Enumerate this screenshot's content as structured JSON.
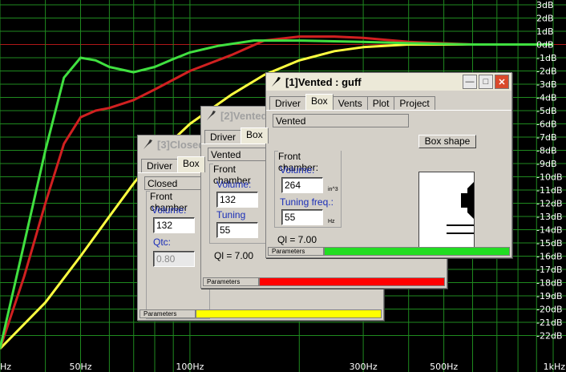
{
  "plot": {
    "db_labels": [
      "3dB",
      "2dB",
      "1dB",
      "0dB",
      "-1dB",
      "-2dB",
      "-3dB",
      "-4dB",
      "-5dB",
      "-6dB",
      "-7dB",
      "-8dB",
      "-9dB",
      "-10dB",
      "-11dB",
      "-12dB",
      "-13dB",
      "-14dB",
      "-15dB",
      "-16dB",
      "-17dB",
      "-18dB",
      "-19dB",
      "-20dB",
      "-21dB",
      "-22dB"
    ],
    "hz_labels": [
      {
        "label": "Hz",
        "f": 30
      },
      {
        "label": "50Hz",
        "f": 50
      },
      {
        "label": "100Hz",
        "f": 100
      },
      {
        "label": "300Hz",
        "f": 300
      },
      {
        "label": "500Hz",
        "f": 500
      },
      {
        "label": "1kHz",
        "f": 1000
      }
    ],
    "grid_color": "#1f8a1f",
    "zero_line_color": "#b01818",
    "curves": [
      {
        "color": "#ffff40",
        "points": [
          [
            30,
            -23
          ],
          [
            40,
            -19.5
          ],
          [
            50,
            -16
          ],
          [
            60,
            -13
          ],
          [
            70,
            -10.5
          ],
          [
            80,
            -8.5
          ],
          [
            100,
            -6
          ],
          [
            130,
            -3.8
          ],
          [
            160,
            -2.3
          ],
          [
            200,
            -1.2
          ],
          [
            250,
            -0.5
          ],
          [
            300,
            -0.2
          ],
          [
            400,
            0
          ],
          [
            600,
            0
          ],
          [
            1000,
            0
          ]
        ]
      },
      {
        "color": "#d02020",
        "points": [
          [
            30,
            -23
          ],
          [
            35,
            -17.5
          ],
          [
            40,
            -12
          ],
          [
            45,
            -7.5
          ],
          [
            50,
            -5.5
          ],
          [
            55,
            -5
          ],
          [
            60,
            -4.8
          ],
          [
            70,
            -4.2
          ],
          [
            80,
            -3.4
          ],
          [
            100,
            -2
          ],
          [
            130,
            -0.8
          ],
          [
            160,
            0.3
          ],
          [
            200,
            0.6
          ],
          [
            250,
            0.6
          ],
          [
            300,
            0.5
          ],
          [
            400,
            0.2
          ],
          [
            600,
            0
          ],
          [
            1000,
            0
          ]
        ]
      },
      {
        "color": "#40e040",
        "points": [
          [
            30,
            -23
          ],
          [
            35,
            -15
          ],
          [
            40,
            -8
          ],
          [
            45,
            -2.5
          ],
          [
            50,
            -1
          ],
          [
            55,
            -1.2
          ],
          [
            60,
            -1.7
          ],
          [
            70,
            -2.1
          ],
          [
            80,
            -1.7
          ],
          [
            90,
            -1.1
          ],
          [
            100,
            -0.6
          ],
          [
            120,
            -0.1
          ],
          [
            150,
            0.3
          ],
          [
            200,
            0.3
          ],
          [
            300,
            0.2
          ],
          [
            400,
            0.1
          ],
          [
            600,
            0
          ],
          [
            1000,
            0
          ]
        ]
      }
    ]
  },
  "windows": {
    "w3": {
      "title": "[3]Closed",
      "tabs": [
        "Driver",
        "Box"
      ],
      "box_type": "Closed",
      "group_label": "Front chamber",
      "volume_label": "Volume:",
      "volume_value": "132",
      "qtc_label": "Qtc:",
      "qtc_value": "0.80",
      "status_tab": "Parameters",
      "status_color": "#ffff00"
    },
    "w2": {
      "title": "[2]Vented",
      "tabs": [
        "Driver",
        "Box"
      ],
      "box_type": "Vented",
      "group_label": "Front chamber",
      "volume_label": "Volume:",
      "volume_value": "132",
      "tuning_label": "Tuning freq.:",
      "tuning_value": "55",
      "ql": "Ql = 7.00",
      "status_tab": "Parameters",
      "status_color": "#ff0000"
    },
    "w1": {
      "title": "[1]Vented : guff",
      "tabs": [
        "Driver",
        "Box",
        "Vents",
        "Plot",
        "Project"
      ],
      "box_type": "Vented",
      "box_shape_button": "Box shape",
      "group_label": "Front chamber:",
      "volume_label": "Volume:",
      "volume_value": "264",
      "volume_unit": "in^3",
      "tuning_label": "Tuning freq.:",
      "tuning_value": "55",
      "tuning_unit": "Hz",
      "ql": "Ql = 7.00",
      "status_tab": "Parameters",
      "status_color": "#22dd22"
    }
  },
  "icons": {
    "window_icon": "speaker-wrench-icon",
    "minimize": "minimize-icon",
    "maximize": "maximize-icon",
    "close": "close-icon"
  }
}
